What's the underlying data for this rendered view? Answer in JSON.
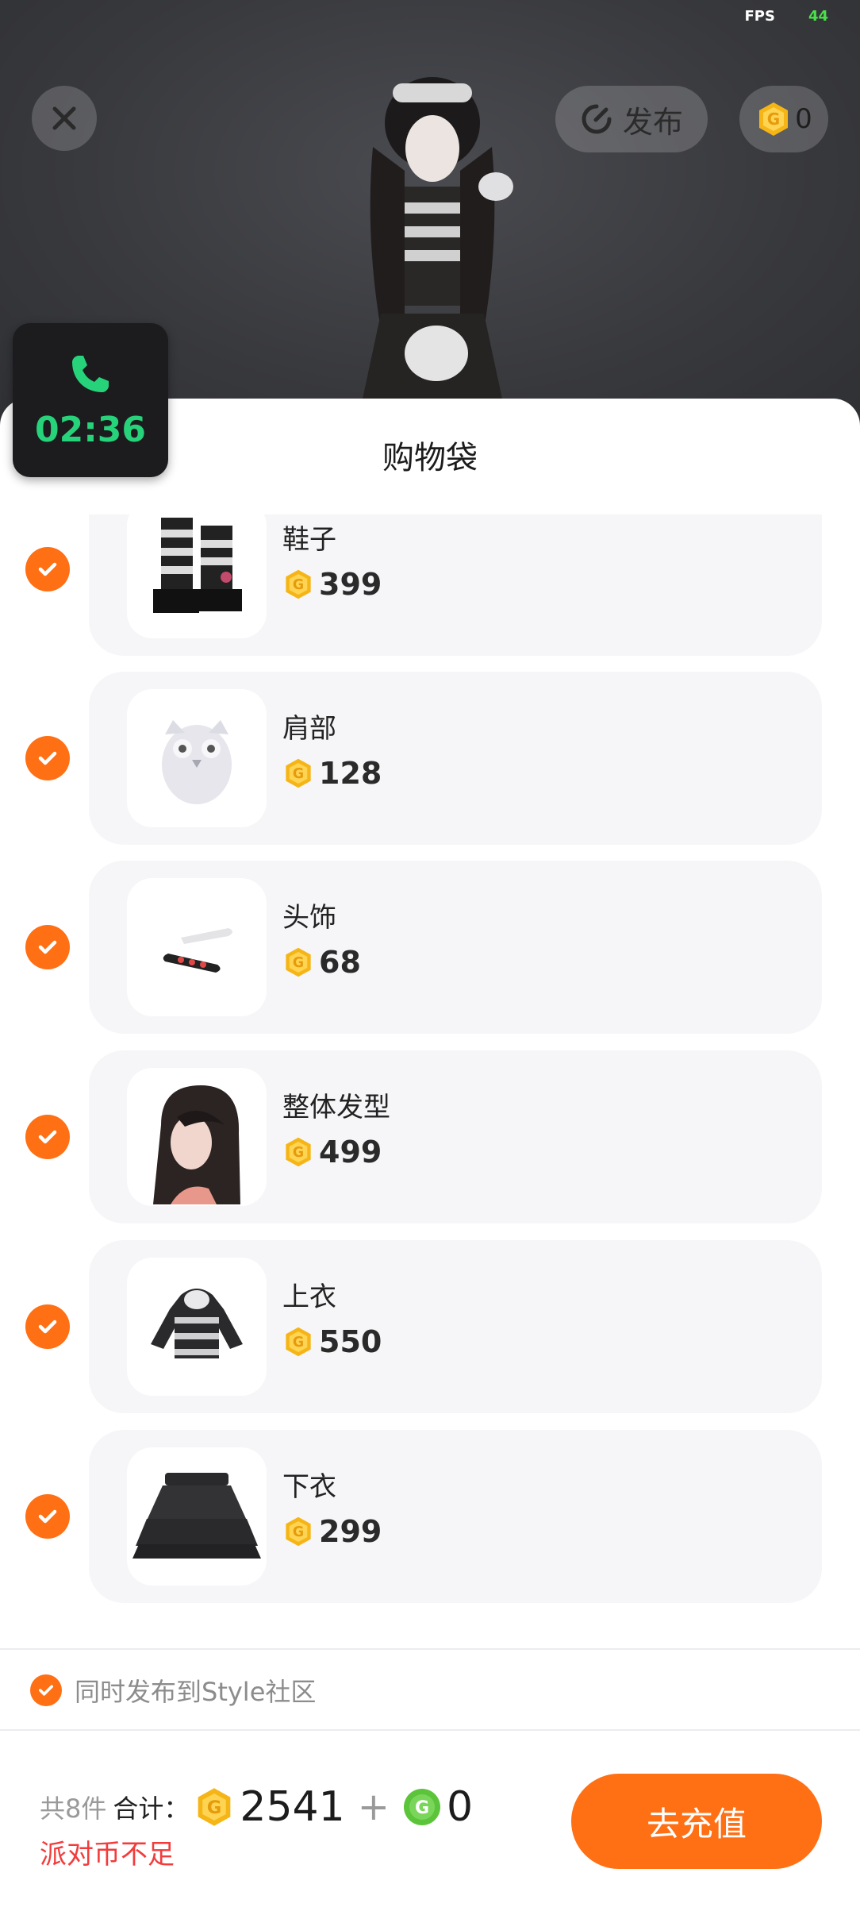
{
  "status": {
    "fps_label": "FPS",
    "fps_value": "44"
  },
  "topbar": {
    "publish_label": "发布",
    "coin_balance": "0"
  },
  "call": {
    "duration": "02:36"
  },
  "sheet": {
    "title": "购物袋"
  },
  "items": [
    {
      "name": "鞋子",
      "price": "399",
      "selected": true,
      "icon": "boots-icon"
    },
    {
      "name": "肩部",
      "price": "128",
      "selected": true,
      "icon": "owl-icon"
    },
    {
      "name": "头饰",
      "price": "68",
      "selected": true,
      "icon": "hairclip-icon"
    },
    {
      "name": "整体发型",
      "price": "499",
      "selected": true,
      "icon": "hair-icon"
    },
    {
      "name": "上衣",
      "price": "550",
      "selected": true,
      "icon": "hoodie-icon"
    },
    {
      "name": "下衣",
      "price": "299",
      "selected": true,
      "icon": "skirt-icon"
    }
  ],
  "community": {
    "label": "同时发布到Style社区",
    "checked": true
  },
  "footer": {
    "count_label": "共8件",
    "total_label": "合计：",
    "coin_total": "2541",
    "plus": "+",
    "green_total": "0",
    "warning": "派对币不足",
    "recharge_label": "去充值"
  },
  "colors": {
    "accent": "#ff6f14",
    "coin_gold": "#f5b517",
    "green_coin": "#5cc43a",
    "call_green": "#27d37a",
    "warning": "#f23c3c"
  }
}
